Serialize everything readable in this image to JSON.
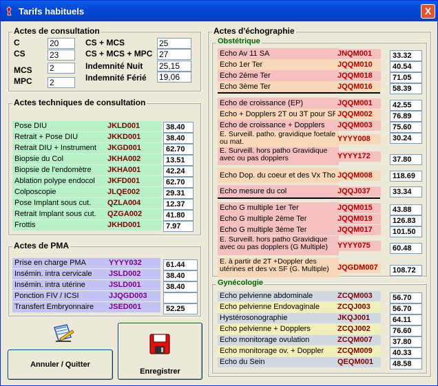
{
  "window": {
    "title": "Tarifs habituels",
    "close": "X"
  },
  "consultation": {
    "title": "Actes de consultation",
    "fields": [
      {
        "label": "C",
        "value": "20"
      },
      {
        "label": "CS",
        "value": "23"
      },
      {
        "label": "MCS",
        "value": "2"
      },
      {
        "label": "MPC",
        "value": "2"
      }
    ],
    "fields2": [
      {
        "label": "CS + MCS",
        "value": "25"
      },
      {
        "label": "CS + MCS + MPC",
        "value": "27"
      },
      {
        "label": "Indemnité Nuit",
        "value": "25,15"
      },
      {
        "label": "Indemnité Férié",
        "value": "19,06"
      }
    ]
  },
  "techniques": {
    "title": "Actes techniques de consultation",
    "rows": [
      {
        "label": "Pose DIU",
        "code": "JKLD001",
        "value": "38.40"
      },
      {
        "label": "Retrait + Pose DIU",
        "code": "JKKD001",
        "value": "38.40"
      },
      {
        "label": "Retrait DIU + Instrument",
        "code": "JKGD001",
        "value": "62.70"
      },
      {
        "label": "Biopsie du Col",
        "code": "JKHA002",
        "value": "13.51"
      },
      {
        "label": "Biopsie de l'endomètre",
        "code": "JKHA001",
        "value": "42.24"
      },
      {
        "label": "Ablation polype endocol",
        "code": "JKFD001",
        "value": "62.70"
      },
      {
        "label": "Colposcopie",
        "code": "JLQE002",
        "value": "29.31"
      },
      {
        "label": "Pose Implant sous cut.",
        "code": "QZLA004",
        "value": "12.37"
      },
      {
        "label": "Retrait Implant sous cut.",
        "code": "QZGA002",
        "value": "41.80"
      },
      {
        "label": "Frottis",
        "code": "JKHD001",
        "value": "7.97"
      }
    ]
  },
  "pma": {
    "title": "Actes de PMA",
    "rows": [
      {
        "label": "Prise en charge PMA",
        "code": "YYYY032",
        "value": "61.44"
      },
      {
        "label": "Insémin. intra cervicale",
        "code": "JSLD002",
        "value": "38.40"
      },
      {
        "label": "Insémin. intra utérine",
        "code": "JSLD001",
        "value": "38.40"
      },
      {
        "label": "Ponction FIV / ICSI",
        "code": "JJQGD003",
        "value": ""
      },
      {
        "label": "Transfert Embryonnaire",
        "code": "JSED001",
        "value": "52.25"
      }
    ]
  },
  "echo": {
    "title": "Actes d'échographie",
    "obstetrique": "Obstétrique",
    "gynecologie": "Gynécologie",
    "obst_rows": [
      {
        "label": "Echo Av 11 SA",
        "code": "JNQM001",
        "value": "33.32"
      },
      {
        "label": "Echo 1er Ter",
        "code": "JQQM010",
        "value": "40.54"
      },
      {
        "label": "Echo 2ème Ter",
        "code": "JQQM018",
        "value": "71.05"
      },
      {
        "label": "Echo 3ème Ter",
        "code": "JQQM016",
        "value": "58.39"
      },
      {
        "label": "Echo de croissance (EP)",
        "code": "JQQM001",
        "value": "42.55"
      },
      {
        "label": "Echo + Dopplers 2T ou 3T pour SF",
        "code": "JQQM002",
        "value": "76.89"
      },
      {
        "label": "Echo de croissance + Dopplers",
        "code": "JQQM003",
        "value": "75.60"
      },
      {
        "label": "E. Surveill. patho. gravidique foetale ou mat.",
        "code": "YYYY008",
        "value": "30.24"
      },
      {
        "label": "E. Surveill. hors patho Gravidique avec ou pas dopplers",
        "code": "YYYY172",
        "value": "37.80"
      },
      {
        "label": "Echo Dop. du coeur et des Vx Tho.",
        "code": "JQQM008",
        "value": "118.69"
      },
      {
        "label": "Echo mesure du col",
        "code": "JQQJ037",
        "value": "33.34"
      },
      {
        "label": "Echo G multiple 1er Ter",
        "code": "JQQM015",
        "value": "43.88"
      },
      {
        "label": "Echo G multiple 2ème Ter",
        "code": "JQQM019",
        "value": "126.83"
      },
      {
        "label": "Echo G multiple 3ème Ter",
        "code": "JQQM017",
        "value": "101.50"
      },
      {
        "label": "E. Surveill. hors patho Gravidique avec ou pas dopplers (G Multiple)",
        "code": "YYYY075",
        "value": "60.48"
      },
      {
        "label": "E. à partir de 2T +Doppler des utérines et des vx SF (G. Multiple)",
        "code": "JQGDM007",
        "value": "108.72"
      }
    ],
    "gyn_rows": [
      {
        "label": "Echo pelvienne abdominale",
        "code": "ZCQM003",
        "value": "56.70"
      },
      {
        "label": "Echo pelvienne Endovaginale",
        "code": "ZCQJ003",
        "value": "56.70"
      },
      {
        "label": "Hystérosonographie",
        "code": "JKQJ001",
        "value": "64.11"
      },
      {
        "label": "Echo pelvienne + Dopplers",
        "code": "ZCQJ002",
        "value": "76.60"
      },
      {
        "label": "Echo monitorage ovulation",
        "code": "ZCQM007",
        "value": "37.80"
      },
      {
        "label": "Echo monitorage ov. + Doppler",
        "code": "ZCQM009",
        "value": "40.33"
      },
      {
        "label": "Echo du Sein",
        "code": "QEQM001",
        "value": "48.58"
      }
    ]
  },
  "buttons": {
    "cancel": "Annuler / Quitter",
    "save": "Enregistrer"
  },
  "colors": {
    "green": "#b8f0c8",
    "blue": "#c4c4f4",
    "pink": "#f4c0c0",
    "peach": "#f8d8b8",
    "gray": "#d0d8e0",
    "yellow": "#f0f0b8"
  }
}
